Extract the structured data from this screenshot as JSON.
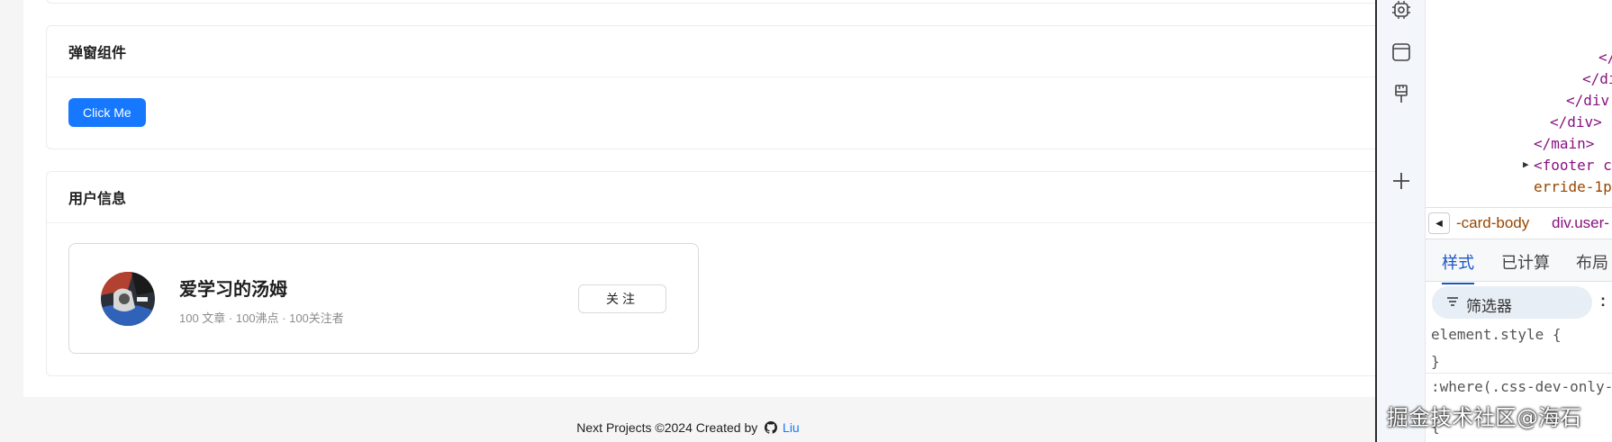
{
  "modal_section": {
    "title": "弹窗组件",
    "button_label": "Click Me"
  },
  "user_section": {
    "title": "用户信息",
    "user_name": "爱学习的汤姆",
    "stats": "100 文章 · 100沸点 · 100关注者",
    "follow_label": "关注"
  },
  "footer": {
    "text": "Next Projects ©2024 Created by",
    "author": "Liu"
  },
  "colors": {
    "primary": "#1677ff",
    "devtools_tag": "#881280",
    "devtools_tab_active": "#1a56c6"
  },
  "devtools": {
    "code_lines": [
      "</",
      "</di",
      "</div",
      "</div>",
      "</main>",
      "<footer c",
      "erride-1p"
    ],
    "breadcrumb": [
      "-card-body",
      "div.user-"
    ],
    "tabs": [
      "样式",
      "已计算",
      "布局"
    ],
    "filter_placeholder": "筛选器",
    "rules": [
      "element.style {",
      "}",
      ":where(.css-dev-only-",
      "{"
    ],
    "rail_icons": [
      "settings-chip-icon",
      "window-icon",
      "paint-brush-icon",
      "plus-icon"
    ]
  },
  "watermark": "掘金技术社区@海石"
}
